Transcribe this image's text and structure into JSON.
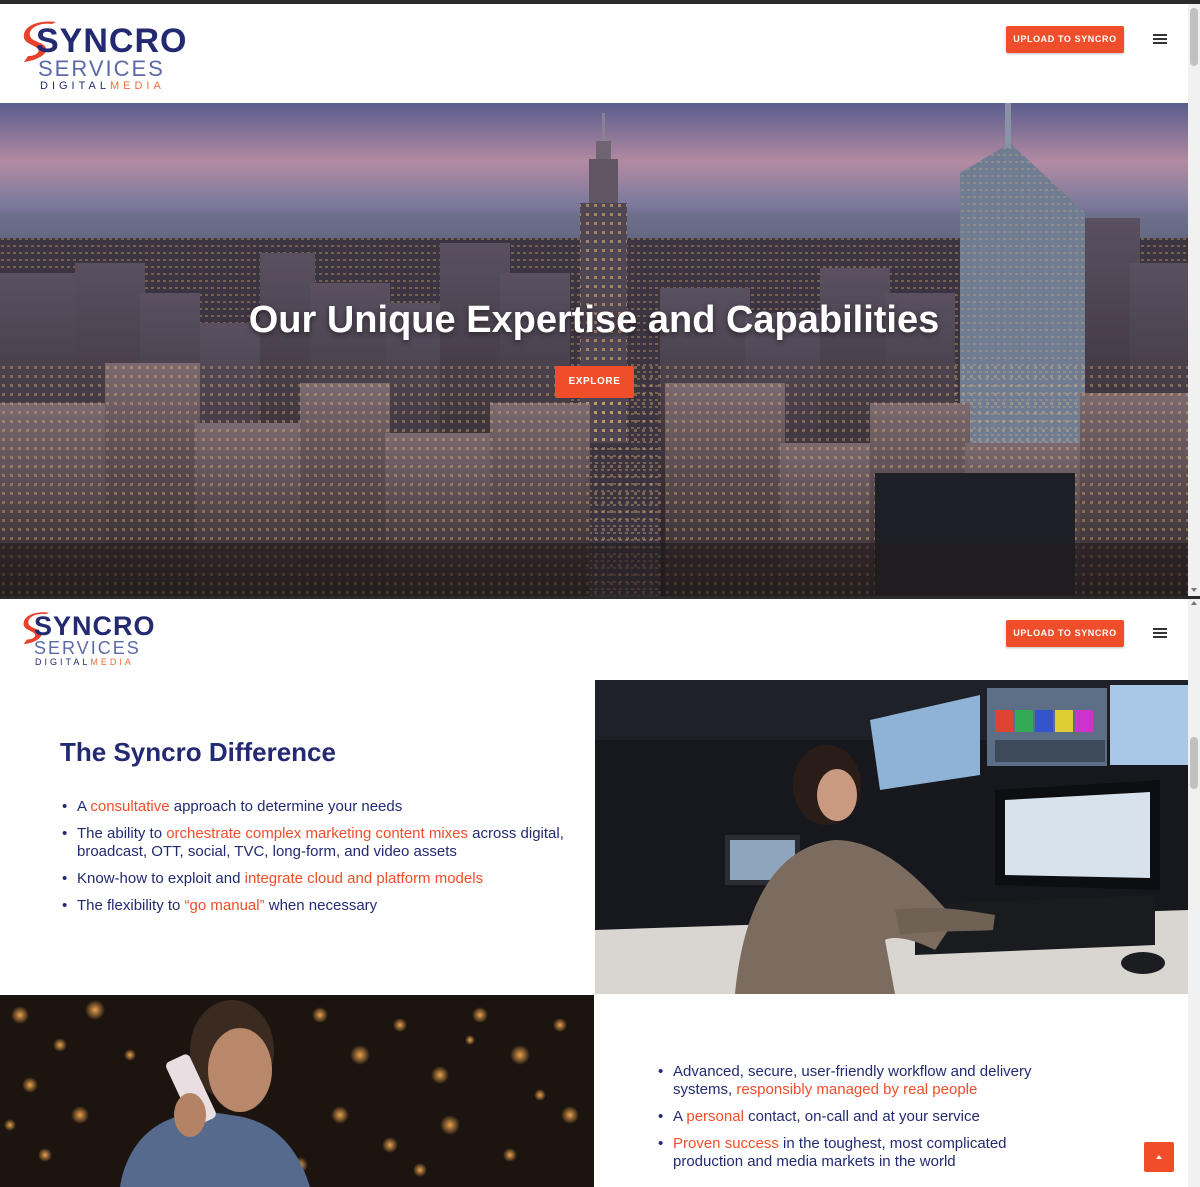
{
  "brand": {
    "name_line1": "SYNCRO",
    "name_line2": "SERVICES",
    "tagline_part1": "DIGITAL",
    "tagline_part2": "MEDIA",
    "colors": {
      "navy": "#232a72",
      "accent": "#f04e2b"
    }
  },
  "header": {
    "upload_label": "UPLOAD TO SYNCRO",
    "menu_icon": "hamburger-menu-icon"
  },
  "hero": {
    "title": "Our Unique Expertise and Capabilities",
    "button_label": "EXPLORE"
  },
  "difference": {
    "title": "The Syncro Difference",
    "items": [
      {
        "before": "A ",
        "highlight": "consultative",
        "after": " approach to determine your needs"
      },
      {
        "before": "The ability to ",
        "highlight": "orchestrate complex marketing content mixes",
        "after": " across digital, broadcast, OTT, social, TVC, long-form, and video assets"
      },
      {
        "before": "Know-how to exploit and ",
        "highlight": "integrate cloud and platform models",
        "after": ""
      },
      {
        "before": "The flexibility to ",
        "highlight": "“go manual”",
        "after": " when necessary"
      }
    ]
  },
  "advantages": {
    "items": [
      {
        "before": "Advanced, secure, user-friendly workflow and delivery systems, ",
        "highlight": "responsibly managed by real people",
        "after": ""
      },
      {
        "before": "A ",
        "highlight": "personal",
        "after": " contact, on-call and at your service"
      },
      {
        "before": "",
        "highlight": "Proven success",
        "after": " in the toughest, most complicated production and media markets in the world"
      }
    ]
  },
  "back_to_top_icon": "chevron-up-icon"
}
